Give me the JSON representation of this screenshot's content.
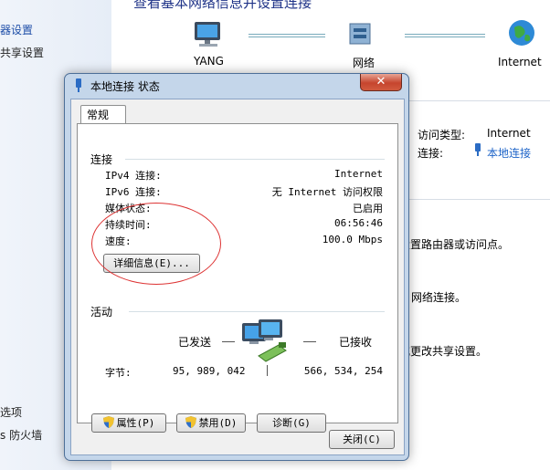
{
  "background": {
    "heading": "查看基本网络信息并设置连接",
    "left_links": [
      "器设置",
      "共享设置"
    ],
    "left_bottom": [
      "选项",
      "s 防火墙"
    ],
    "network_map": {
      "computer": "YANG",
      "network": "网络",
      "internet": "Internet"
    },
    "access_type_label": "访问类型:",
    "access_type_value": "Internet",
    "connections_label": "连接:",
    "connections_value": "本地连接",
    "task_lines": [
      "设置路由器或访问点。",
      "网络连接。",
      "或更改共享设置。"
    ]
  },
  "dialog": {
    "title": "本地连接 状态",
    "close_glyph": "✕",
    "tab": "常规",
    "connection": {
      "section": "连接",
      "rows": [
        {
          "label": "IPv4 连接:",
          "value": "Internet"
        },
        {
          "label": "IPv6 连接:",
          "value": "无 Internet 访问权限"
        },
        {
          "label": "媒体状态:",
          "value": "已启用"
        },
        {
          "label": "持续时间:",
          "value": "06:56:46"
        },
        {
          "label": "速度:",
          "value": "100.0 Mbps"
        }
      ],
      "details_button": "详细信息(E)..."
    },
    "activity": {
      "section": "活动",
      "sent_label": "已发送",
      "received_label": "已接收",
      "bytes_label": "字节:",
      "sent_value": "95, 989, 042",
      "received_value": "566, 534, 254"
    },
    "buttons": {
      "properties": "属性(P)",
      "disable": "禁用(D)",
      "diagnose": "诊断(G)",
      "close": "关闭(C)"
    }
  },
  "colors": {
    "link": "#1e4ea8",
    "heading": "#1e3287",
    "annotation": "#dd3333",
    "close_button": "#c6452e"
  }
}
